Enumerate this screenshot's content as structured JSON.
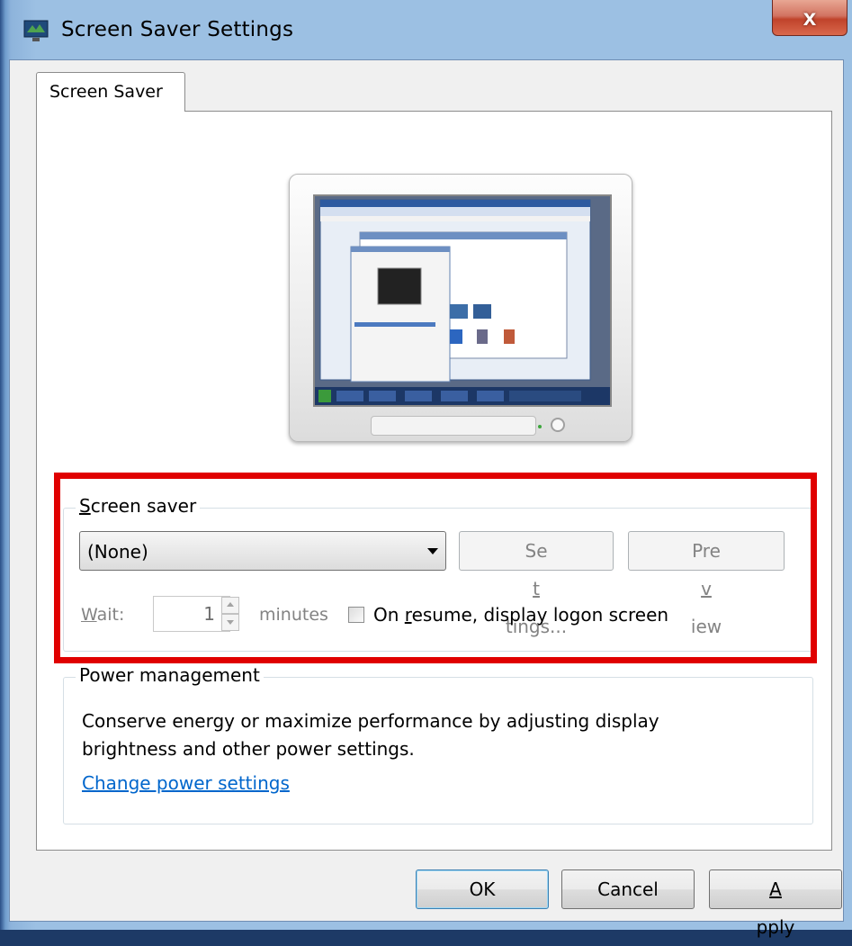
{
  "window": {
    "title": "Screen Saver Settings",
    "close_label": "x"
  },
  "tabs": [
    {
      "label": "Screen Saver"
    }
  ],
  "screen_saver": {
    "legend_first": "S",
    "legend_rest": "creen saver",
    "selected": "(None)",
    "settings_pre": "Se",
    "settings_u": "t",
    "settings_post": "tings...",
    "preview_pre": "Pre",
    "preview_u": "v",
    "preview_post": "iew",
    "wait_u": "W",
    "wait_rest": "ait:",
    "wait_value": "1",
    "minutes_label": "minutes",
    "resume_pre": "On ",
    "resume_u": "r",
    "resume_post": "esume, display logon screen"
  },
  "power_management": {
    "legend": "Power management",
    "description": "Conserve energy or maximize performance by adjusting display brightness and other power settings.",
    "link": "Change power settings"
  },
  "buttons": {
    "ok": "OK",
    "cancel": "Cancel",
    "apply_u": "A",
    "apply_rest": "pply"
  },
  "icons": {
    "title": "screen-saver-app-icon",
    "monitor": "monitor-preview-icon",
    "dropdown": "chevron-down-icon"
  }
}
